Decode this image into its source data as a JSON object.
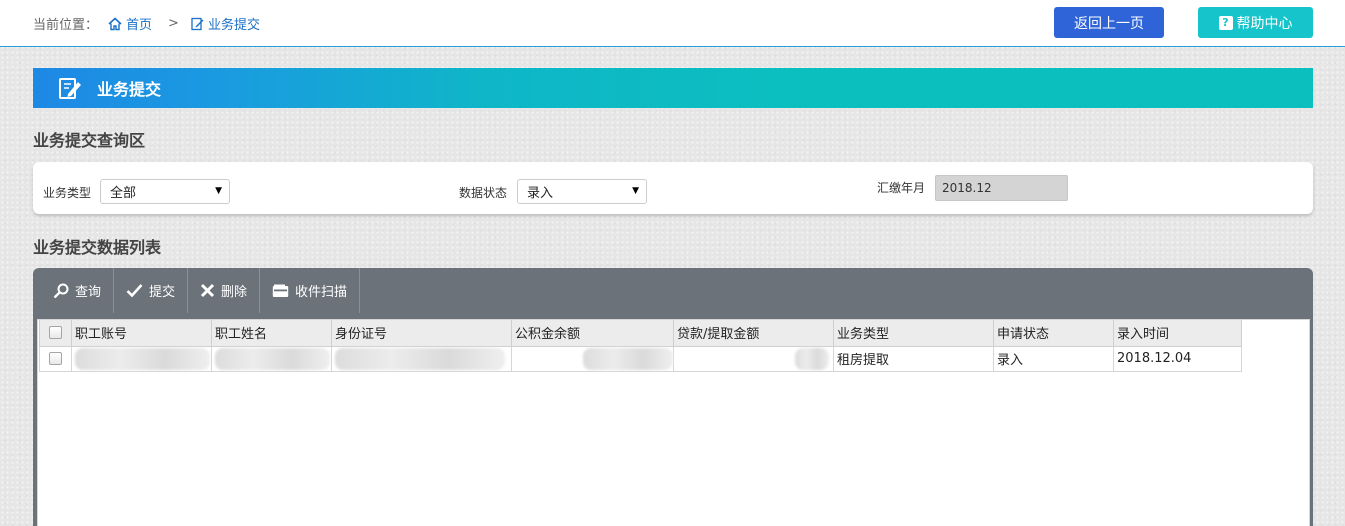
{
  "breadcrumb": {
    "label": "当前位置：",
    "home": "首页",
    "separator": ">",
    "current": "业务提交"
  },
  "header_buttons": {
    "back": "返回上一页",
    "help": "帮助中心"
  },
  "banner": {
    "title": "业务提交"
  },
  "query_section": {
    "title": "业务提交查询区",
    "business_type_label": "业务类型",
    "business_type_value": "全部",
    "data_status_label": "数据状态",
    "data_status_value": "录入",
    "pay_month_label": "汇缴年月",
    "pay_month_value": "2018.12"
  },
  "list_section": {
    "title": "业务提交数据列表",
    "toolbar": [
      "查询",
      "提交",
      "删除",
      "收件扫描"
    ]
  },
  "table": {
    "columns": [
      "职工账号",
      "职工姓名",
      "身份证号",
      "公积金余额",
      "贷款/提取金额",
      "业务类型",
      "申请状态",
      "录入时间"
    ],
    "rows": [
      {
        "business_type": "租房提取",
        "status": "录入",
        "entry_time": "2018.12.04"
      }
    ]
  },
  "colors": {
    "accent_blue": "#2f64d8",
    "accent_teal": "#16c4cc",
    "toolbar_bg": "#6b7279",
    "link": "#1a6fc7"
  }
}
